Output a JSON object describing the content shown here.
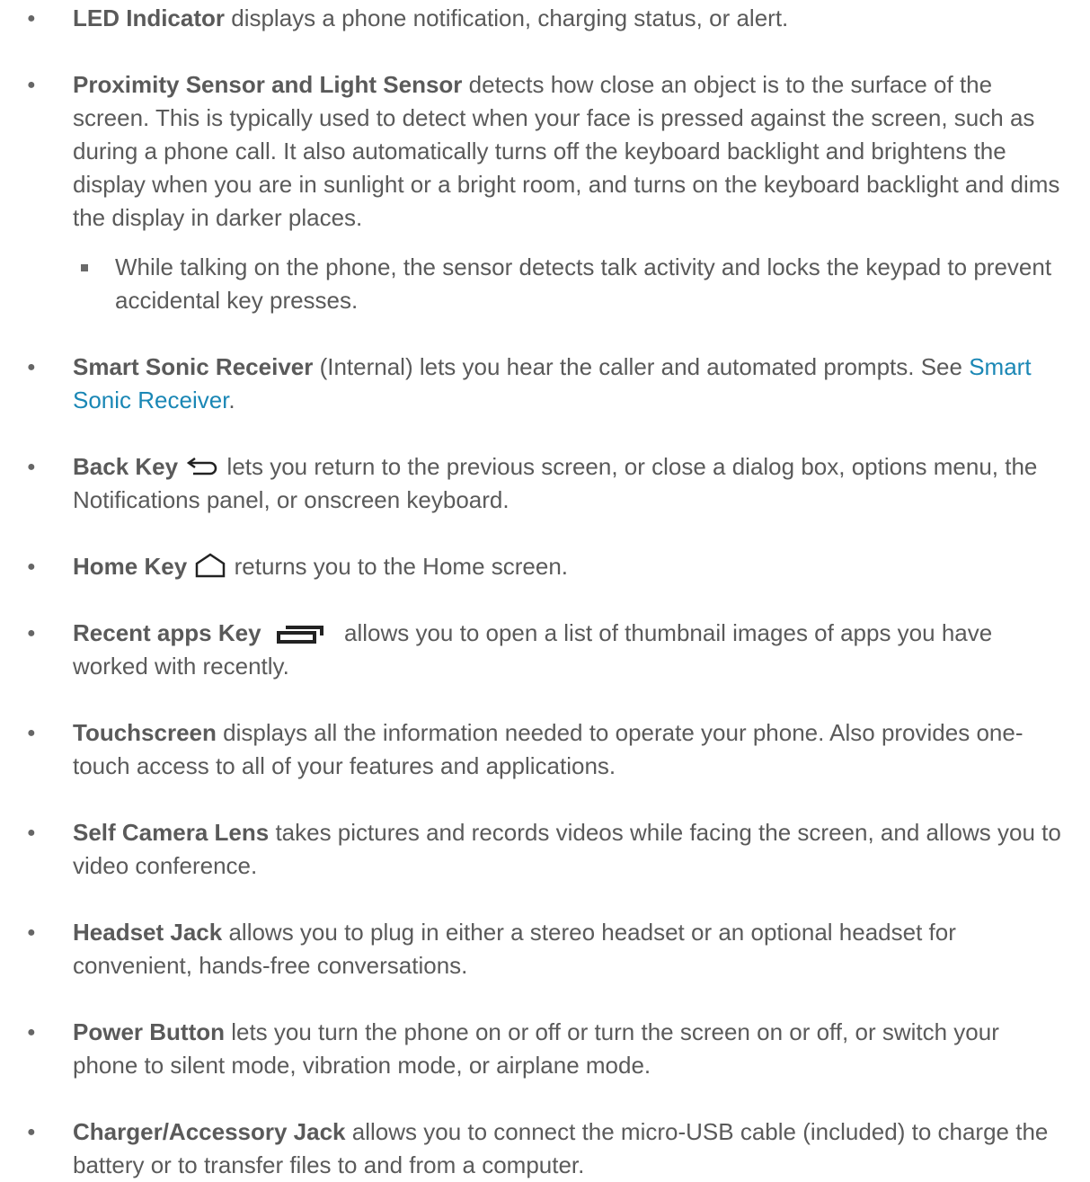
{
  "items": [
    {
      "term": "LED Indicator",
      "desc": " displays a phone notification, charging status, or alert."
    },
    {
      "term": "Proximity Sensor and Light Sensor",
      "desc": " detects how close an object is to the surface of the screen. This is typically used to detect when your face is pressed against the screen, such as during a phone call. It also automatically turns off the keyboard backlight and brightens the display when you are in sunlight or a bright room, and turns on the keyboard backlight and dims the display in darker places."
    },
    {
      "sub": "While talking on the phone, the sensor detects talk activity and locks the keypad to prevent accidental key presses."
    },
    {
      "term": "Smart Sonic Receiver",
      "desc": " (Internal) lets you hear the caller and automated prompts. See ",
      "link": "Smart Sonic Receiver",
      "after": "."
    },
    {
      "term": "Back Key",
      "icon": "back-arrow-icon",
      "desc": " lets you return to the previous screen, or close a dialog box, options menu, the Notifications panel, or onscreen keyboard."
    },
    {
      "term": "Home Key",
      "icon": "home-outline-icon",
      "desc": " returns you to the Home screen."
    },
    {
      "term": "Recent apps Key",
      "icon": "recent-apps-icon",
      "desc": " allows you to open a list of thumbnail images of apps you have worked with recently."
    },
    {
      "term": "Touchscreen",
      "desc": " displays all the information needed to operate your phone. Also provides one-touch access to all of your features and applications."
    },
    {
      "term": "Self Camera Lens",
      "desc": " takes pictures and records videos while facing the screen, and allows you to video conference."
    },
    {
      "term": "Headset Jack",
      "desc": " allows you to plug in either a stereo headset or an optional headset for convenient, hands-free conversations."
    },
    {
      "term": "Power Button",
      "desc": " lets you turn the phone on or off or turn the screen on or off, or switch your phone to silent mode, vibration mode, or airplane mode."
    },
    {
      "term": "Charger/Accessory Jack",
      "desc": " allows you to connect the micro-USB cable (included) to charge the battery or to transfer files to and from a computer."
    }
  ],
  "colors": {
    "text": "#5a5a5a",
    "link": "#1a87b5"
  }
}
